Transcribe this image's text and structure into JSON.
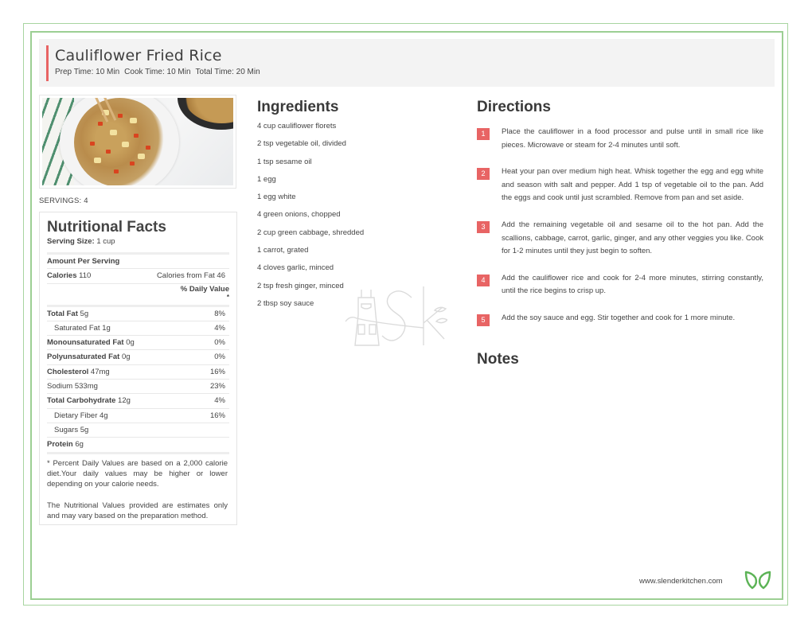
{
  "header": {
    "title": "Cauliflower Fried Rice",
    "prep_time": "Prep Time: 10 Min",
    "cook_time": "Cook Time: 10 Min",
    "total_time": "Total Time: 20 Min"
  },
  "servings": "SERVINGS: 4",
  "nutrition": {
    "title": "Nutritional Facts",
    "serving_size_label": "Serving Size:",
    "serving_size_value": "1 cup",
    "amount_per_serving": "Amount Per Serving",
    "calories_label": "Calories",
    "calories_value": "110",
    "calories_from_fat": "Calories from Fat 46",
    "daily_value_label": "% Daily Value",
    "daily_value_star": "*",
    "rows": [
      {
        "label": "Total Fat",
        "value": "5g",
        "dv": "8%",
        "bold": true,
        "indent": false
      },
      {
        "label": "Saturated Fat",
        "value": "1g",
        "dv": "4%",
        "bold": false,
        "indent": true
      },
      {
        "label": "Monounsaturated Fat",
        "value": "0g",
        "dv": "0%",
        "bold": true,
        "indent": false
      },
      {
        "label": "Polyunsaturated Fat",
        "value": "0g",
        "dv": "0%",
        "bold": true,
        "indent": false
      },
      {
        "label": "Cholesterol",
        "value": "47mg",
        "dv": "16%",
        "bold": true,
        "indent": false
      },
      {
        "label": "Sodium",
        "value": "533mg",
        "dv": "23%",
        "bold": false,
        "indent": false
      },
      {
        "label": "Total Carbohydrate",
        "value": "12g",
        "dv": "4%",
        "bold": true,
        "indent": false
      },
      {
        "label": "Dietary Fiber",
        "value": "4g",
        "dv": "16%",
        "bold": false,
        "indent": true
      },
      {
        "label": "Sugars",
        "value": "5g",
        "dv": "",
        "bold": false,
        "indent": true
      },
      {
        "label": "Protein",
        "value": "6g",
        "dv": "",
        "bold": true,
        "indent": false
      }
    ],
    "disclaimer_1": "* Percent Daily Values are based on a 2,000 calorie diet.Your daily values may be higher or lower depending on your calorie needs.",
    "disclaimer_2": "The Nutritional Values provided are estimates only and may vary based on the preparation method."
  },
  "ingredients": {
    "title": "Ingredients",
    "items": [
      "4 cup cauliflower florets",
      "2 tsp vegetable oil, divided",
      "1 tsp sesame oil",
      "1 egg",
      "1 egg white",
      "4 green onions, chopped",
      "2 cup green cabbage, shredded",
      "1 carrot, grated",
      "4 cloves garlic, minced",
      "2 tsp fresh ginger, minced",
      "2 tbsp soy sauce"
    ]
  },
  "directions": {
    "title": "Directions",
    "steps": [
      {
        "num": "1",
        "text": "Place the cauliflower in a food processor and pulse until in small rice like pieces. Microwave or steam for 2-4 minutes until soft."
      },
      {
        "num": "2",
        "text": "Heat your pan over medium high heat. Whisk together the egg and egg white and season with salt and pepper. Add 1 tsp of vegetable oil to the pan. Add the eggs and cook until just scrambled. Remove from pan and set aside."
      },
      {
        "num": "3",
        "text": "Add the remaining vegetable oil and sesame oil to the hot pan. Add the scallions, cabbage, carrot, garlic, ginger, and any other veggies you like. Cook for 1-2 minutes until they just begin to soften."
      },
      {
        "num": "4",
        "text": "Add the cauliflower rice and cook for 2-4 more minutes, stirring constantly, until the rice begins to crisp up."
      },
      {
        "num": "5",
        "text": "Add the soy sauce and egg. Stir together and cook for 1 more minute."
      }
    ]
  },
  "notes": {
    "title": "Notes"
  },
  "footer": {
    "url": "www.slenderkitchen.com"
  },
  "colors": {
    "accent": "#e86464",
    "frame": "#9ccf93",
    "logo": "#5cb356"
  }
}
